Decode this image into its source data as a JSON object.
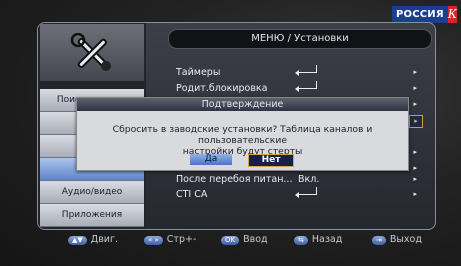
{
  "channel": {
    "name": "РОССИЯ",
    "mark": "К"
  },
  "header": {
    "title": "МЕНЮ / Установки"
  },
  "sidebar": {
    "items": [
      {
        "label": "Поиск каналов"
      },
      {
        "label": "П"
      },
      {
        "label": "Пре"
      },
      {
        "label": "Ус"
      },
      {
        "label": "Аудио/видео"
      },
      {
        "label": "Приложения"
      }
    ]
  },
  "menu": {
    "rows": [
      {
        "label": "Таймеры",
        "value": "",
        "arrow": "▸"
      },
      {
        "label": "Родит.блокировка",
        "value": "",
        "arrow": "▸"
      },
      {
        "label": "После перебоя питан...",
        "value": "Вкл.",
        "arrow": "▸"
      },
      {
        "label": "CTI CA",
        "value": "",
        "arrow": "▸"
      }
    ],
    "side_arrows": [
      "▸",
      "▸",
      "▸",
      "▸"
    ]
  },
  "dialog": {
    "title": "Подтверждение",
    "message_line1": "Сбросить в заводские установки? Таблица каналов и пользовательские",
    "message_line2": "настройки будут стерты",
    "yes_label": "Да",
    "no_label": "Нет"
  },
  "footer": {
    "items": [
      {
        "key": "▲▼",
        "label": "Двиг."
      },
      {
        "key": "«  »",
        "label": "Стр+-"
      },
      {
        "key": "OK",
        "label": "Ввод"
      },
      {
        "key": "⇆",
        "label": "Назад"
      },
      {
        "key": "⇥",
        "label": "Выход"
      }
    ]
  }
}
